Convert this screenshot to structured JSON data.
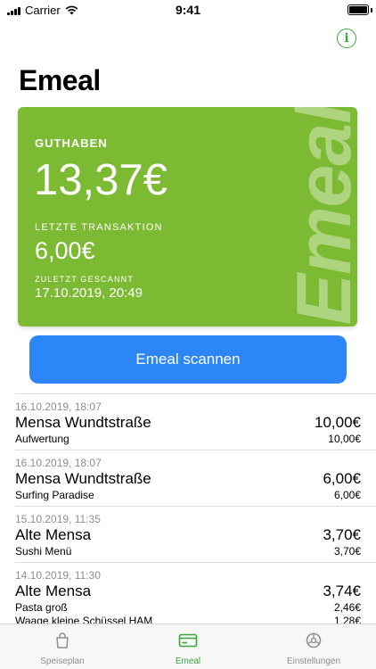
{
  "status": {
    "carrier": "Carrier",
    "time": "9:41"
  },
  "header": {
    "title": "Emeal"
  },
  "card": {
    "watermark": "Emeal",
    "balance_label": "GUTHABEN",
    "balance": "13,37€",
    "last_tx_label": "LETZTE TRANSAKTION",
    "last_tx": "6,00€",
    "scanned_label": "ZULETZT GESCANNT",
    "scanned": "17.10.2019, 20:49",
    "color": "#7dba33"
  },
  "scan_button": {
    "label": "Emeal scannen",
    "color": "#2c86f7"
  },
  "transactions": [
    {
      "date": "16.10.2019, 18:07",
      "place": "Mensa Wundtstraße",
      "total": "10,00€",
      "items": [
        {
          "name": "Aufwertung",
          "amount": "10,00€"
        }
      ]
    },
    {
      "date": "16.10.2019, 18:07",
      "place": "Mensa Wundtstraße",
      "total": "6,00€",
      "items": [
        {
          "name": "Surfing Paradise",
          "amount": "6,00€"
        }
      ]
    },
    {
      "date": "15.10.2019, 11:35",
      "place": "Alte Mensa",
      "total": "3,70€",
      "items": [
        {
          "name": "Sushi Menü",
          "amount": "3,70€"
        }
      ]
    },
    {
      "date": "14.10.2019, 11:30",
      "place": "Alte Mensa",
      "total": "3,74€",
      "items": [
        {
          "name": "Pasta groß",
          "amount": "2,46€"
        },
        {
          "name": "Waage kleine Schüssel HAM",
          "amount": "1,28€"
        }
      ]
    }
  ],
  "tabs": [
    {
      "label": "Speiseplan",
      "icon": "bag-icon",
      "active": false
    },
    {
      "label": "Emeal",
      "icon": "card-icon",
      "active": true
    },
    {
      "label": "Einstellungen",
      "icon": "gear-icon",
      "active": false
    }
  ],
  "accent_color": "#3aa63a"
}
